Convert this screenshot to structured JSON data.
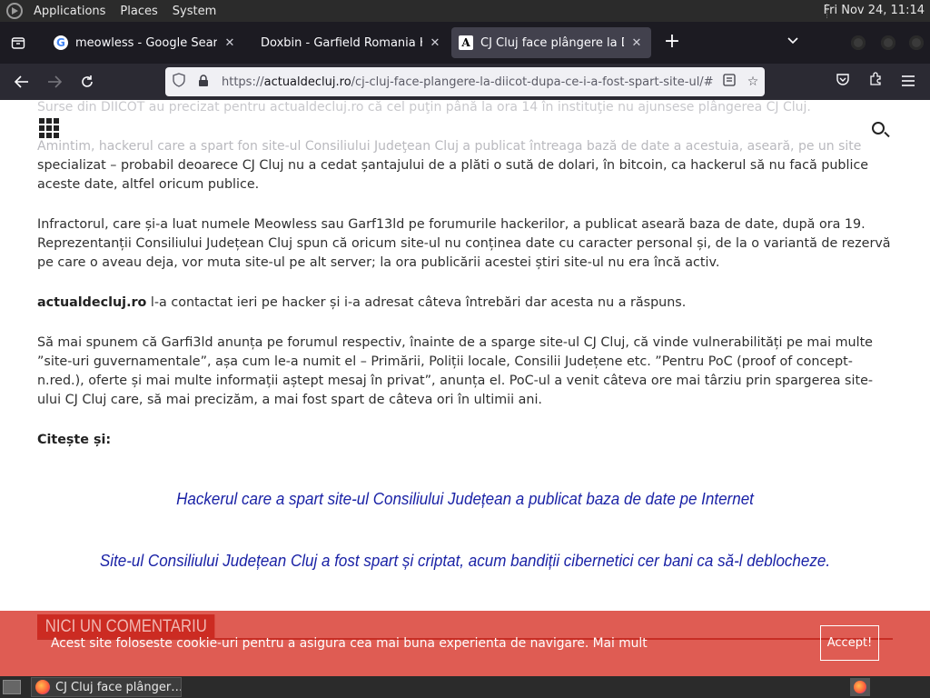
{
  "top_panel": {
    "menus": [
      "Applications",
      "Places",
      "System"
    ],
    "clock": "Fri Nov 24, 11:14"
  },
  "tabs": [
    {
      "title": "meowless - Google Search",
      "icon": "google-icon",
      "active": false
    },
    {
      "title": "Doxbin - Garfield Romania Hack",
      "icon": "none",
      "active": false
    },
    {
      "title": "CJ Cluj face plângere la DIICOT",
      "icon": "article-icon",
      "active": true
    }
  ],
  "urlbar": {
    "prefix": "https://",
    "domain": "actualdecluj.ro",
    "path": "/cj-cluj-face-plangere-la-diicot-dupa-ce-i-a-fost-spart-site-ul/#"
  },
  "article": {
    "faded_top": "Surse din DIICOT au precizat pentru actualdecluj.ro că cel puţin până la ora 14 în instituţie nu ajunsese plângerea CJ Cluj.",
    "faded_second": "Amintim, hackerul care a spart fon site-ul Consiliului Judeţean Cluj a publicat întreaga bază de date a acestuia, aseară, pe un site",
    "para1": "specializat – probabil deoarece CJ Cluj nu a  cedat șantajului de a plăti o sută de dolari, în bitcoin, ca hackerul să nu facă publice aceste date, altfel oricum publice.",
    "para2": "Infractorul, care și-a luat numele Meowless sau Garf13ld pe forumurile hackerilor, a publicat aseară baza de date, după ora 19. Reprezentanții Consiliului Județean Cluj spun că oricum site-ul nu conținea date cu caracter personal și, de la o variantă de rezervă pe care o aveau deja, vor muta site-ul pe alt server; la ora publicării acestei știri site-ul nu era încă activ.",
    "para3_strong": "actualdecluj.ro",
    "para3_rest": " l-a contactat ieri pe hacker și i-a adresat câteva întrebări dar acesta nu a răspuns.",
    "para4": "Să mai spunem că Garfi3ld anunța pe forumul respectiv, înainte de a sparge site-ul CJ Cluj, că vinde vulnerabilități pe mai multe ”site-uri guvernamentale”, așa cum le-a numit el – Primării, Poliții locale, Consilii Județene etc. ”Pentru PoC (proof of concept-n.red.), oferte și mai multe informații aștept mesaj în privat”, anunța el. PoC-ul a venit câteva ore mai târziu prin spargerea site-ului CJ Cluj care, să mai precizăm, a mai fost spart de câteva ori în ultimii ani.",
    "read_also": "Citește și:",
    "related": [
      "Hackerul care a spart site-ul Consiliului Județean a publicat baza de date pe Internet",
      "Site-ul Consiliului Județean Cluj a fost spart și criptat, acum bandiții cibernetici cer bani ca să-l deblocheze."
    ]
  },
  "cookie": {
    "heading": "NICI UN COMENTARIU",
    "message": "Acest site foloseste cookie-uri pentru a asigura cea mai buna experienta de navigare. Mai mult",
    "accept": "Accept!"
  },
  "taskbar": {
    "window_title": "CJ Cluj face plânger…"
  }
}
